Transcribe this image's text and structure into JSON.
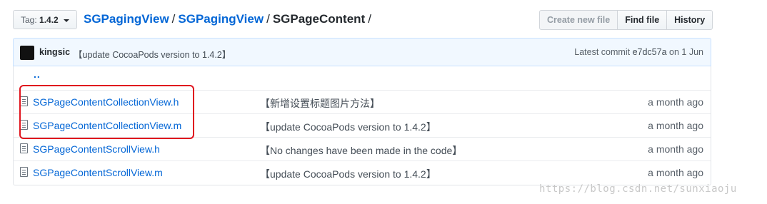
{
  "header": {
    "tag_label": "Tag:",
    "tag_value": "1.4.2",
    "breadcrumb": [
      "SGPagingView",
      "SGPagingView",
      "SGPageContent"
    ],
    "separator": "/",
    "buttons": [
      "Create new file",
      "Find file",
      "History"
    ]
  },
  "commit": {
    "author": "kingsic",
    "message": "【update CocoaPods version to 1.4.2】",
    "latest_label": "Latest commit",
    "sha": "e7dc57a",
    "date": "on 1 Jun"
  },
  "files": {
    "up_dir": "..",
    "rows": [
      {
        "name": "SGPageContentCollectionView.h",
        "message": "【新增设置标题图片方法】",
        "age": "a month ago"
      },
      {
        "name": "SGPageContentCollectionView.m",
        "message": "【update CocoaPods version to 1.4.2】",
        "age": "a month ago"
      },
      {
        "name": "SGPageContentScrollView.h",
        "message": "【No changes have been made in the code】",
        "age": "a month ago"
      },
      {
        "name": "SGPageContentScrollView.m",
        "message": "【update CocoaPods version to 1.4.2】",
        "age": "a month ago"
      }
    ]
  },
  "watermark": "https://blog.csdn.net/sunxiaoju",
  "colors": {
    "link": "#0366d6",
    "highlight_box": "#e0141e",
    "commit_bar": "#f1f8ff"
  }
}
